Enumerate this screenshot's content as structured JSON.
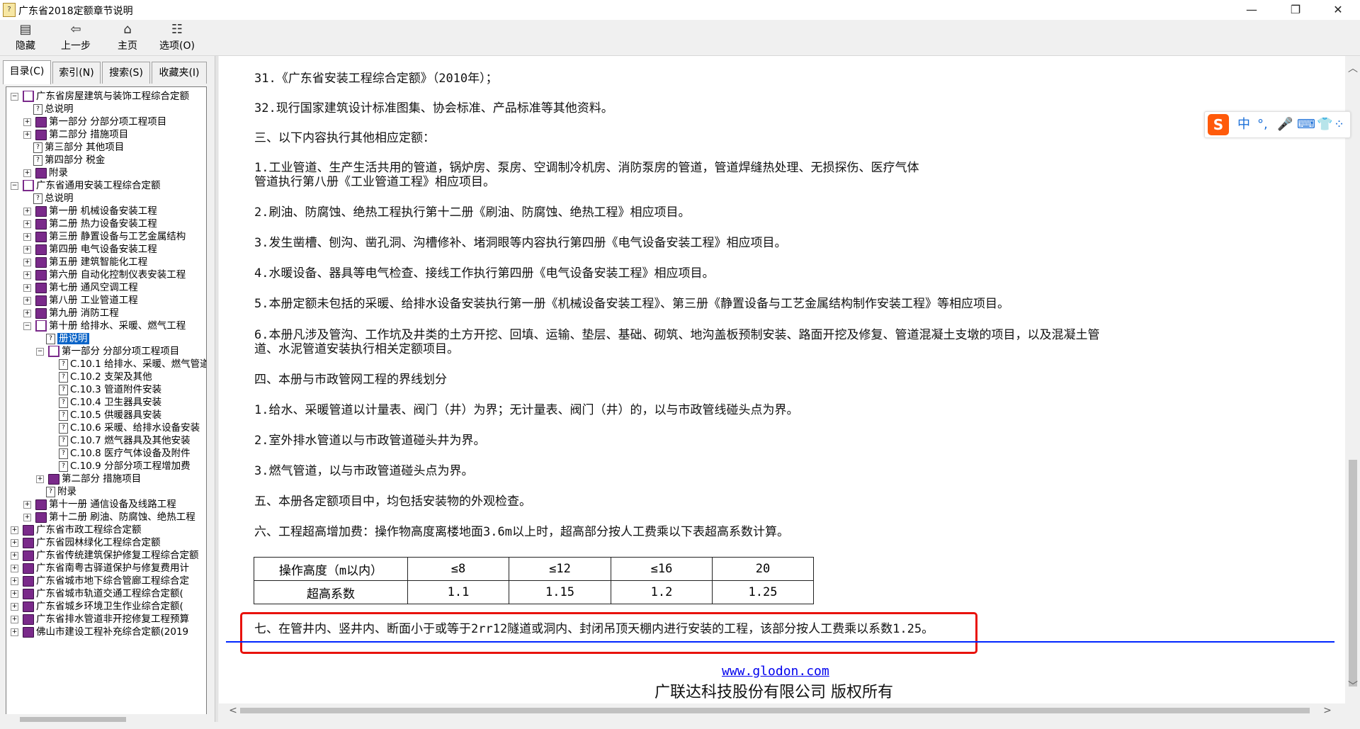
{
  "window": {
    "title": "广东省2018定额章节说明",
    "icon": "help-book-icon",
    "buttons": {
      "minimize": "—",
      "maximize": "❐",
      "close": "✕"
    }
  },
  "toolbar": {
    "hide": "隐藏",
    "back": "上一步",
    "home": "主页",
    "options": "选项(O)"
  },
  "tabs": [
    "目录(C)",
    "索引(N)",
    "搜索(S)",
    "收藏夹(I)"
  ],
  "tree": [
    {
      "text": "广东省房屋建筑与装饰工程综合定额",
      "level": 0,
      "type": "book-open",
      "exp": "−"
    },
    {
      "text": "总说明",
      "level": 1,
      "type": "page"
    },
    {
      "text": "第一部分  分部分项工程项目",
      "level": 1,
      "type": "book",
      "exp": "+"
    },
    {
      "text": "第二部分  措施项目",
      "level": 1,
      "type": "book",
      "exp": "+"
    },
    {
      "text": "第三部分  其他项目",
      "level": 1,
      "type": "page"
    },
    {
      "text": "第四部分  税金",
      "level": 1,
      "type": "page"
    },
    {
      "text": "附录",
      "level": 1,
      "type": "book",
      "exp": "+"
    },
    {
      "text": "广东省通用安装工程综合定额",
      "level": 0,
      "type": "book-open",
      "exp": "−"
    },
    {
      "text": "总说明",
      "level": 1,
      "type": "page"
    },
    {
      "text": "第一册  机械设备安装工程",
      "level": 1,
      "type": "book",
      "exp": "+"
    },
    {
      "text": "第二册  热力设备安装工程",
      "level": 1,
      "type": "book",
      "exp": "+"
    },
    {
      "text": "第三册  静置设备与工艺金属结构",
      "level": 1,
      "type": "book",
      "exp": "+"
    },
    {
      "text": "第四册  电气设备安装工程",
      "level": 1,
      "type": "book",
      "exp": "+"
    },
    {
      "text": "第五册  建筑智能化工程",
      "level": 1,
      "type": "book",
      "exp": "+"
    },
    {
      "text": "第六册  自动化控制仪表安装工程",
      "level": 1,
      "type": "book",
      "exp": "+"
    },
    {
      "text": "第七册  通风空调工程",
      "level": 1,
      "type": "book",
      "exp": "+"
    },
    {
      "text": "第八册  工业管道工程",
      "level": 1,
      "type": "book",
      "exp": "+"
    },
    {
      "text": "第九册  消防工程",
      "level": 1,
      "type": "book",
      "exp": "+"
    },
    {
      "text": "第十册  给排水、采暖、燃气工程",
      "level": 1,
      "type": "book-open",
      "exp": "−"
    },
    {
      "text": "册说明",
      "level": 2,
      "type": "page",
      "selected": true
    },
    {
      "text": "第一部分  分部分项工程项目",
      "level": 2,
      "type": "book-open",
      "exp": "−"
    },
    {
      "text": "C.10.1  给排水、采暖、燃气管道",
      "level": 3,
      "type": "page"
    },
    {
      "text": "C.10.2  支架及其他",
      "level": 3,
      "type": "page"
    },
    {
      "text": "C.10.3  管道附件安装",
      "level": 3,
      "type": "page"
    },
    {
      "text": "C.10.4  卫生器具安装",
      "level": 3,
      "type": "page"
    },
    {
      "text": "C.10.5  供暖器具安装",
      "level": 3,
      "type": "page"
    },
    {
      "text": "C.10.6  采暖、给排水设备安装",
      "level": 3,
      "type": "page"
    },
    {
      "text": "C.10.7  燃气器具及其他安装",
      "level": 3,
      "type": "page"
    },
    {
      "text": "C.10.8  医疗气体设备及附件",
      "level": 3,
      "type": "page"
    },
    {
      "text": "C.10.9  分部分项工程增加费",
      "level": 3,
      "type": "page"
    },
    {
      "text": "第二部分  措施项目",
      "level": 2,
      "type": "book",
      "exp": "+"
    },
    {
      "text": "附录",
      "level": 2,
      "type": "page"
    },
    {
      "text": "第十一册  通信设备及线路工程",
      "level": 1,
      "type": "book",
      "exp": "+"
    },
    {
      "text": "第十二册  刷油、防腐蚀、绝热工程",
      "level": 1,
      "type": "book",
      "exp": "+"
    },
    {
      "text": "广东省市政工程综合定额",
      "level": 0,
      "type": "book",
      "exp": "+"
    },
    {
      "text": "广东省园林绿化工程综合定额",
      "level": 0,
      "type": "book",
      "exp": "+"
    },
    {
      "text": "广东省传统建筑保护修复工程综合定额",
      "level": 0,
      "type": "book",
      "exp": "+"
    },
    {
      "text": "广东省南粤古驿道保护与修复费用计",
      "level": 0,
      "type": "book",
      "exp": "+"
    },
    {
      "text": "广东省城市地下综合管廊工程综合定",
      "level": 0,
      "type": "book",
      "exp": "+"
    },
    {
      "text": "广东省城市轨道交通工程综合定额(",
      "level": 0,
      "type": "book",
      "exp": "+"
    },
    {
      "text": "广东省城乡环境卫生作业综合定额(",
      "level": 0,
      "type": "book",
      "exp": "+"
    },
    {
      "text": "广东省排水管道非开挖修复工程预算",
      "level": 0,
      "type": "book",
      "exp": "+"
    },
    {
      "text": "佛山市建设工程补充综合定额(2019",
      "level": 0,
      "type": "book",
      "exp": "+"
    }
  ],
  "content": {
    "p31": "31.《广东省安装工程综合定额》（2010年）；",
    "p32": "32.现行国家建筑设计标准图集、协会标准、产品标准等其他资料。",
    "h3": "三、以下内容执行其他相应定额：",
    "c1a": "1.工业管道、生产生活共用的管道，锅炉房、泵房、空调制冷机房、消防泵房的管道，管道焊缝热处理、无损探伤、医疗气体",
    "c1b": "管道执行第八册《工业管道工程》相应项目。",
    "c2": "2.刷油、防腐蚀、绝热工程执行第十二册《刷油、防腐蚀、绝热工程》相应项目。",
    "c3": "3.发生凿槽、刨沟、凿孔洞、沟槽修补、堵洞眼等内容执行第四册《电气设备安装工程》相应项目。",
    "c4": "4.水暖设备、器具等电气检查、接线工作执行第四册《电气设备安装工程》相应项目。",
    "c5": "5.本册定额未包括的采暖、给排水设备安装执行第一册《机械设备安装工程》、第三册《静置设备与工艺金属结构制作安装工程》等相应项目。",
    "c6a": "6.本册凡涉及管沟、工作坑及井类的土方开挖、回填、运输、垫层、基础、砌筑、地沟盖板预制安装、路面开挖及修复、管道混凝土支墩的项目，以及混凝土管",
    "c6b": "道、水泥管道安装执行相关定额项目。",
    "h4": "四、本册与市政管网工程的界线划分",
    "d1": "1.给水、采暖管道以计量表、阀门（井）为界；无计量表、阀门（井）的，以与市政管线碰头点为界。",
    "d2": "2.室外排水管道以与市政管道碰头井为界。",
    "d3": "3.燃气管道，以与市政管道碰头点为界。",
    "h5": "五、本册各定额项目中，均包括安装物的外观检查。",
    "h6": "六、工程超高增加费：操作物高度离楼地面3.6m以上时，超高部分按人工费乘以下表超高系数计算。",
    "h7": "七、在管井内、竖井内、断面小于或等于2rr12隧道或洞内、封闭吊顶天棚内进行安装的工程，该部分按人工费乘以系数1.25。",
    "table": {
      "row1": [
        "操作高度（m以内）",
        "≤8",
        "≤12",
        "≤16",
        "20"
      ],
      "row2": [
        "超高系数",
        "1.1",
        "1.15",
        "1.2",
        "1.25"
      ]
    },
    "footer_link": "www.glodon.com",
    "footer_copy": "广联达科技股份有限公司 版权所有"
  },
  "ime": {
    "logo": "S",
    "items": [
      "中",
      "°,",
      "🎤",
      "⌨",
      "👕",
      "⁘"
    ]
  },
  "colors": {
    "selection": "#0a64c8",
    "highlight_box": "#e8120c",
    "separator": "#0026ff",
    "tree_book": "#7a2a8a"
  }
}
